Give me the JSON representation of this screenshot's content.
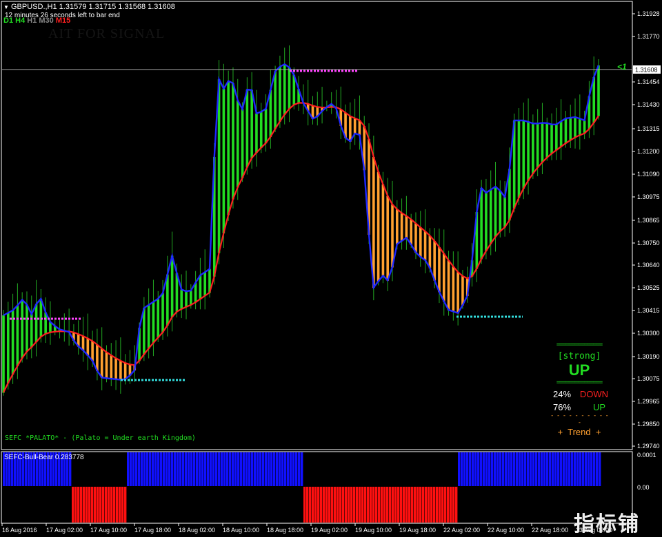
{
  "header": {
    "symbol_line": "GBPUSD.,H1  1.31579 1.31715 1.31568 1.31608",
    "timer": "12 minutes 26 seconds left to bar end",
    "timeframes": [
      {
        "label": "D1",
        "color": "#22dd22"
      },
      {
        "label": "H4",
        "color": "#22dd22"
      },
      {
        "label": "H1",
        "color": "#888888"
      },
      {
        "label": "M30",
        "color": "#888888"
      },
      {
        "label": "M15",
        "color": "#ff2020"
      }
    ],
    "wait_text": "AIT FOR SIGNAL"
  },
  "price_axis": {
    "labels": [
      "1.31928",
      "1.31770",
      "1.31608",
      "1.31454",
      "1.31430",
      "1.31315",
      "1.31200",
      "1.31090",
      "1.30975",
      "1.30865",
      "1.30750",
      "1.30640",
      "1.30525",
      "1.30415",
      "1.30300",
      "1.30190",
      "1.30075",
      "1.29965",
      "1.29850",
      "1.29740"
    ],
    "current_price": "1.31608",
    "arrow_text": "<1"
  },
  "signal_panel": {
    "strength": "[strong]",
    "direction": "UP",
    "down_pct": "24%",
    "down_label": "DOWN",
    "up_pct": "76%",
    "up_label": "UP",
    "trend_label": "+  Trend  +"
  },
  "footer_text": "SEFC *PALATO* - (Palato = Under earth Kingdom)",
  "sub_window": {
    "title": "SEFC-Bull-Bear 0.283778",
    "axis_labels": [
      "0.0001",
      "0.00"
    ]
  },
  "time_axis": [
    "16 Aug 2016",
    "17 Aug 02:00",
    "17 Aug 10:00",
    "17 Aug 18:00",
    "18 Aug 02:00",
    "18 Aug 10:00",
    "18 Aug 18:00",
    "19 Aug 02:00",
    "19 Aug 10:00",
    "19 Aug 18:00",
    "22 Aug 02:00",
    "22 Aug 10:00",
    "22 Aug 18:00",
    "23 Aug 02:00"
  ],
  "watermark": "指标铺",
  "colors": {
    "bull": "#22dd22",
    "bear": "#ffa030",
    "fast_line": "#1e28ff",
    "slow_line": "#ff2020",
    "resistance": "#ff44ff",
    "support": "#33dddd",
    "hist_bull": "#1010ff",
    "hist_bear": "#ff1010"
  }
}
